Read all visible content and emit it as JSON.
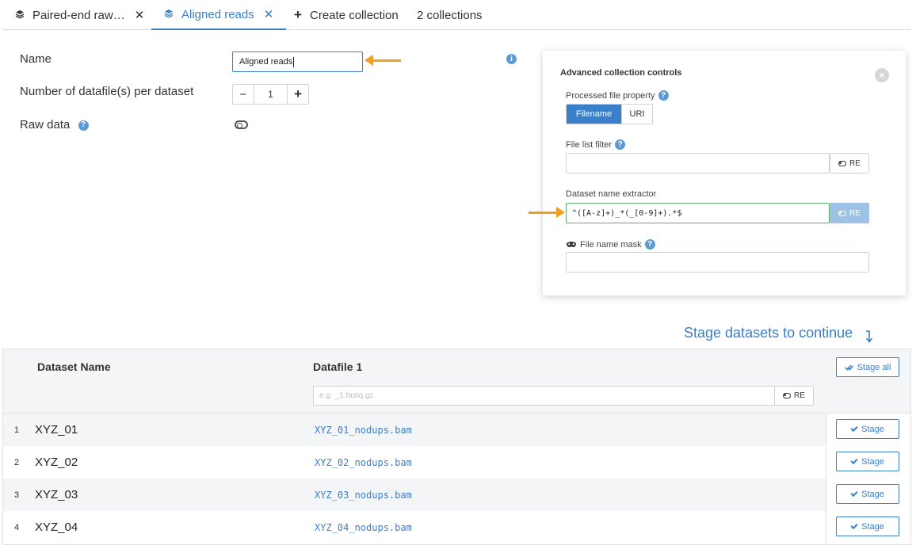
{
  "tabs": [
    {
      "label": "Paired-end raw…",
      "icon": "layers-icon",
      "closable": true,
      "active": false
    },
    {
      "label": "Aligned reads",
      "icon": "layers-icon",
      "closable": true,
      "active": true
    },
    {
      "label": "Create collection",
      "icon": "plus-icon",
      "closable": false,
      "active": false
    },
    {
      "label": "2 collections",
      "closable": false,
      "active": false
    }
  ],
  "form": {
    "name_label": "Name",
    "name_value": "Aligned reads",
    "datafiles_label": "Number of datafile(s) per dataset",
    "datafiles_value": "1",
    "minus_label": "−",
    "plus_label": "+",
    "raw_data_label": "Raw data"
  },
  "advanced": {
    "title": "Advanced collection controls",
    "close_label": "×",
    "processed_property_label": "Processed file property",
    "property_options": [
      "Filename",
      "URI"
    ],
    "property_selected": "Filename",
    "file_list_filter_label": "File list filter",
    "file_list_filter_value": "",
    "re_label": "RE",
    "dataset_name_extractor_label": "Dataset name extractor",
    "dataset_name_extractor_value": "^([A-z]+)_*(_[0-9]+).*$",
    "file_name_mask_label": "File name mask",
    "file_name_mask_value": ""
  },
  "stage_hint": "Stage datasets to continue",
  "table": {
    "col_dataset_name": "Dataset Name",
    "col_datafile": "Datafile 1",
    "filter_placeholder": "e.g. _1.fastq.gz",
    "filter_re_label": "RE",
    "stage_all_label": "Stage all",
    "stage_label": "Stage",
    "rows": [
      {
        "num": "1",
        "name": "XYZ_01",
        "file": "XYZ_01_nodups.bam"
      },
      {
        "num": "2",
        "name": "XYZ_02",
        "file": "XYZ_02_nodups.bam"
      },
      {
        "num": "3",
        "name": "XYZ_03",
        "file": "XYZ_03_nodups.bam"
      },
      {
        "num": "4",
        "name": "XYZ_04",
        "file": "XYZ_04_nodups.bam"
      }
    ]
  },
  "colors": {
    "accent": "#3a7fc9",
    "annotation_arrow": "#f0a020",
    "focus_border": "#5fae6a"
  }
}
